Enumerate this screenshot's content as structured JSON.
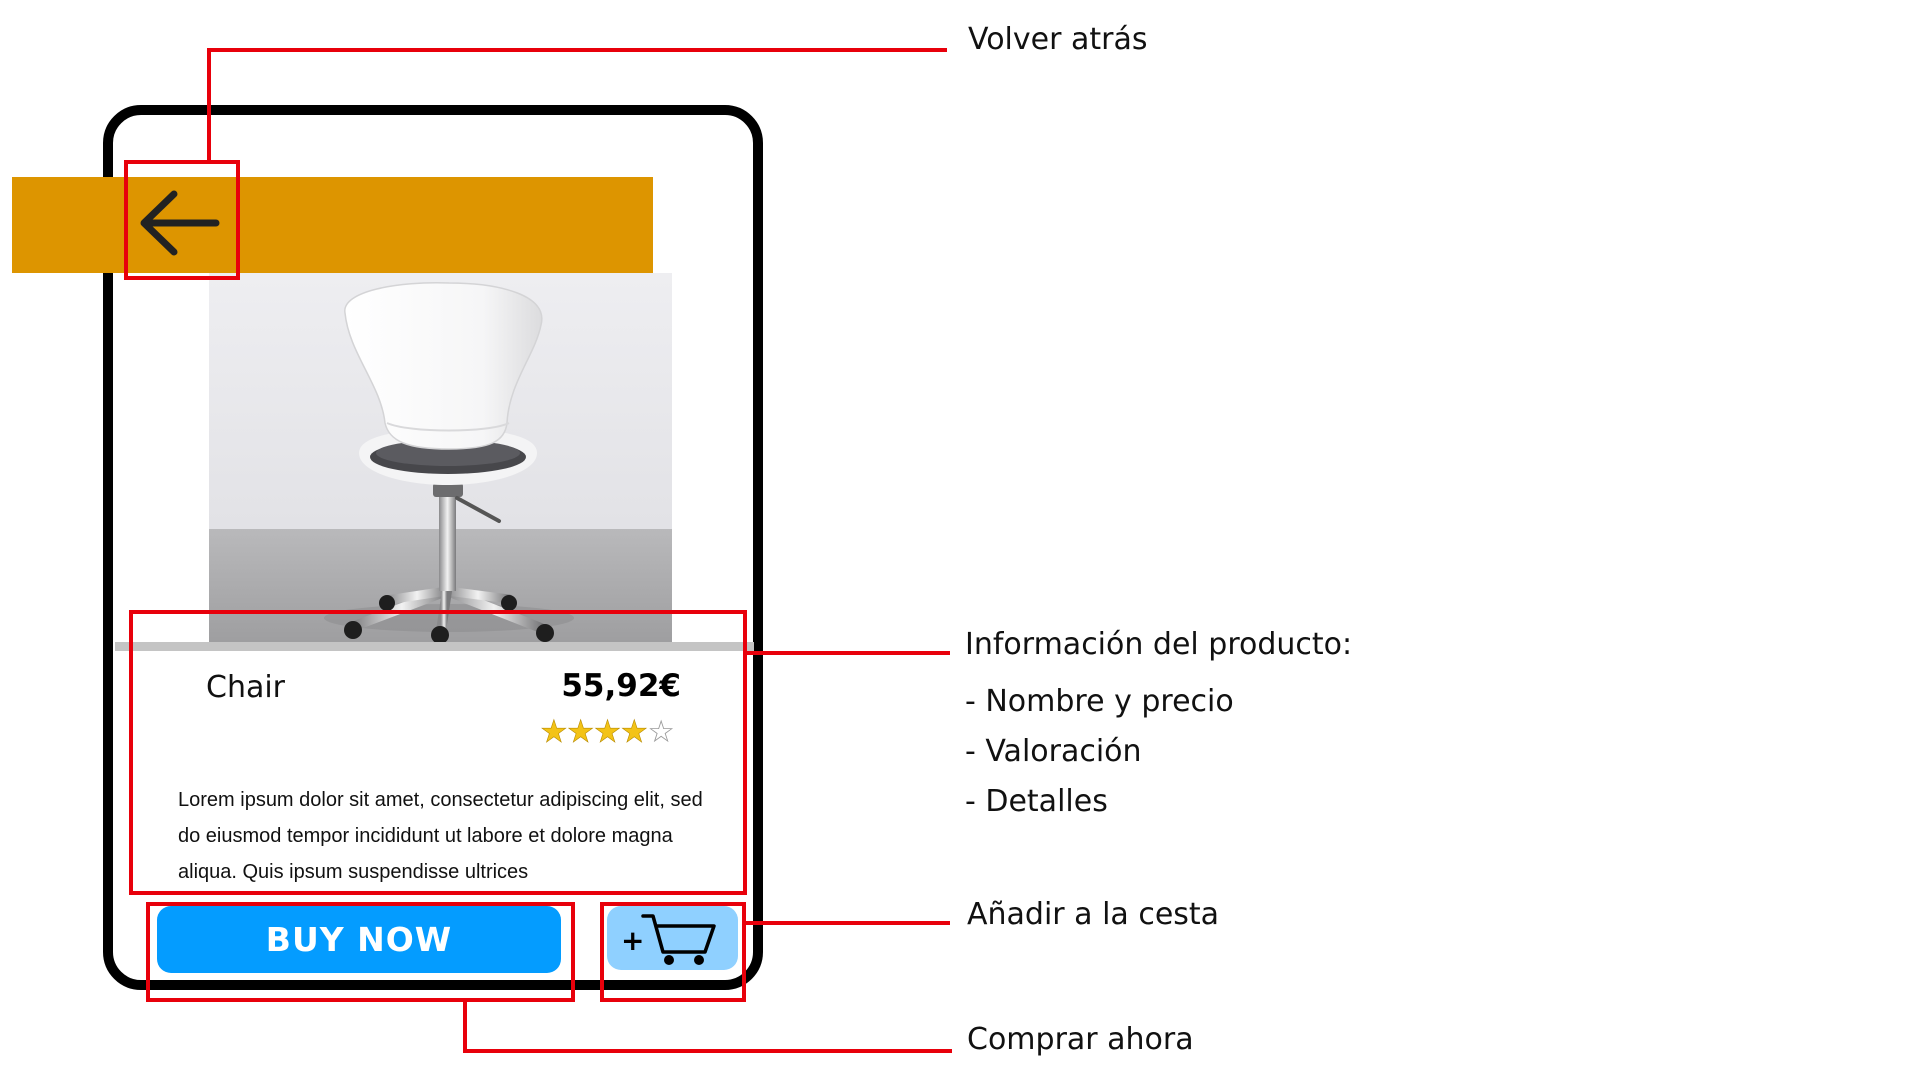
{
  "product": {
    "name": "Chair",
    "price": "55,92€",
    "rating": {
      "value": 4,
      "max": 5
    },
    "description": "Lorem ipsum dolor sit amet, consectetur adipiscing elit, sed do eiusmod tempor incididunt ut labore et dolore magna aliqua. Quis ipsum suspendisse ultrices"
  },
  "buttons": {
    "buy_now": "BUY NOW",
    "add_to_cart_plus": "+"
  },
  "annotations": {
    "back": "Volver atrás",
    "info_title": "Información del producto:",
    "info_items": [
      "- Nombre y precio",
      "- Valoración",
      "- Detalles"
    ],
    "add_to_cart": "Añadir a la cesta",
    "buy_now": "Comprar ahora"
  },
  "colors": {
    "header": "#dd9500",
    "buy_button": "#049cff",
    "cart_button": "#8fd0ff",
    "callout": "#e8000b",
    "star": "#f3c316"
  },
  "icons": {
    "back": "arrow-left-icon",
    "cart": "shopping-cart-icon",
    "star": "star-icon"
  }
}
